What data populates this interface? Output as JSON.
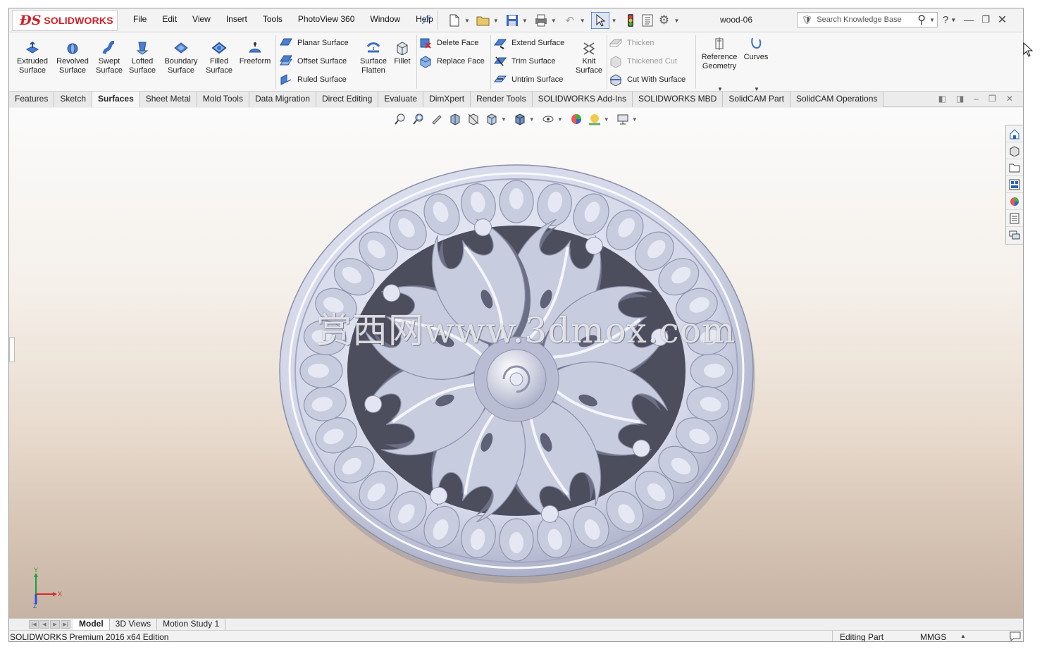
{
  "app": {
    "brand": "SOLIDWORKS",
    "document_title": "wood-06"
  },
  "menu": [
    "File",
    "Edit",
    "View",
    "Insert",
    "Tools",
    "PhotoView 360",
    "Window",
    "Help"
  ],
  "search": {
    "placeholder": "Search Knowledge Base"
  },
  "ribbon": {
    "extruded_surface": "Extruded Surface",
    "revolved_surface": "Revolved Surface",
    "swept_surface": "Swept Surface",
    "lofted_surface": "Lofted Surface",
    "boundary_surface": "Boundary Surface",
    "filled_surface": "Filled Surface",
    "freeform": "Freeform",
    "planar_surface": "Planar Surface",
    "offset_surface": "Offset Surface",
    "ruled_surface": "Ruled Surface",
    "surface_flatten": "Surface Flatten",
    "fillet": "Fillet",
    "delete_face": "Delete Face",
    "replace_face": "Replace Face",
    "extend_surface": "Extend Surface",
    "trim_surface": "Trim Surface",
    "untrim_surface": "Untrim Surface",
    "knit_surface": "Knit Surface",
    "thicken": "Thicken",
    "thickened_cut": "Thickened Cut",
    "cut_with_surface": "Cut With Surface",
    "reference_geometry": "Reference Geometry",
    "curves": "Curves"
  },
  "tabs": [
    {
      "label": "Features",
      "active": false
    },
    {
      "label": "Sketch",
      "active": false
    },
    {
      "label": "Surfaces",
      "active": true
    },
    {
      "label": "Sheet Metal",
      "active": false
    },
    {
      "label": "Mold Tools",
      "active": false
    },
    {
      "label": "Data Migration",
      "active": false
    },
    {
      "label": "Direct Editing",
      "active": false
    },
    {
      "label": "Evaluate",
      "active": false
    },
    {
      "label": "DimXpert",
      "active": false
    },
    {
      "label": "Render Tools",
      "active": false
    },
    {
      "label": "SOLIDWORKS Add-Ins",
      "active": false
    },
    {
      "label": "SOLIDWORKS MBD",
      "active": false
    },
    {
      "label": "SolidCAM Part",
      "active": false
    },
    {
      "label": "SolidCAM Operations",
      "active": false
    }
  ],
  "viewport": {
    "watermark": "赏西网www.3dmox.com",
    "model_color": "#c7ccdf",
    "triad": {
      "x": "X",
      "y": "Y",
      "z": "Z"
    }
  },
  "bottom_tabs": [
    {
      "label": "Model",
      "active": true
    },
    {
      "label": "3D Views",
      "active": false
    },
    {
      "label": "Motion Study 1",
      "active": false
    }
  ],
  "status": {
    "edition": "SOLIDWORKS Premium 2016 x64 Edition",
    "mode": "Editing Part",
    "units": "MMGS"
  },
  "colors": {
    "brand_red": "#d21f26",
    "accent_blue": "#2a62b3"
  }
}
